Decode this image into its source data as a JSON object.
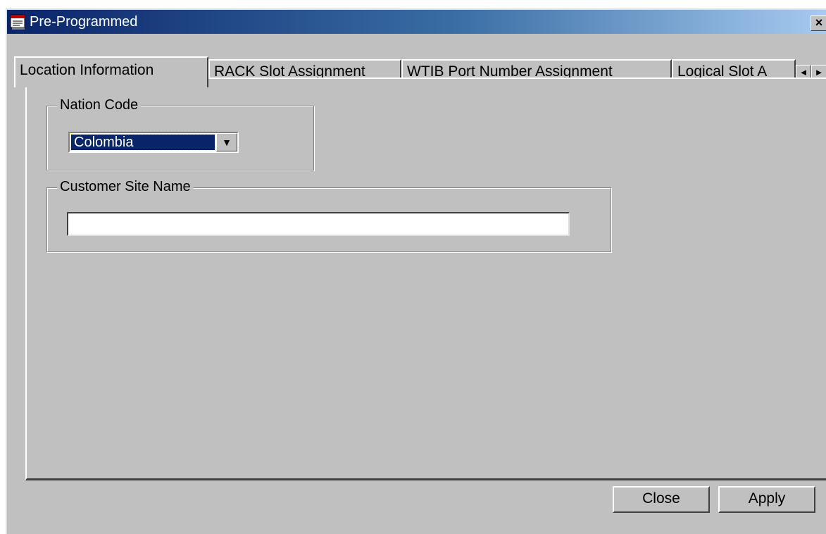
{
  "window": {
    "title": "Pre-Programmed",
    "app_icon": "doc-app-icon",
    "close_symbol": "×"
  },
  "tabs": [
    {
      "label": "Location Information",
      "active": true
    },
    {
      "label": "RACK Slot Assignment",
      "active": false
    },
    {
      "label": "WTIB Port Number Assignment",
      "active": false
    },
    {
      "label": "Logical Slot A",
      "active": false
    }
  ],
  "tab_scroll": {
    "left_symbol": "◄",
    "right_symbol": "►"
  },
  "nation_code": {
    "label": "Nation Code",
    "selected": "Colombia",
    "arrow_symbol": "▼"
  },
  "customer_site": {
    "label": "Customer Site Name",
    "value": "",
    "placeholder": ""
  },
  "buttons": {
    "close": "Close",
    "apply": "Apply"
  },
  "colors": {
    "face": "#c0c0c0",
    "titlebar_start": "#0a246a",
    "titlebar_end": "#a6caf0",
    "selection": "#0a246a"
  }
}
